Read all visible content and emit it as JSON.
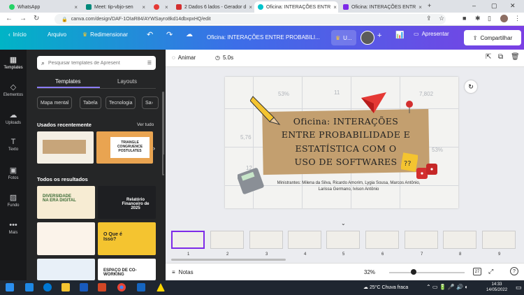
{
  "browser": {
    "tabs": [
      {
        "label": "WhatsApp",
        "color": "#25d366"
      },
      {
        "label": "Meet: tip-vbjo-sen",
        "color": "#00897b"
      },
      {
        "label": "",
        "color": "#e53935"
      },
      {
        "label": "2 Dados 6 lados - Gerador d",
        "color": "#d32f2f"
      },
      {
        "label": "Oficina: INTERAÇÕES ENTR",
        "color": "#00c4cc"
      },
      {
        "label": "Oficina: INTERAÇÕES ENTR",
        "color": "#7d2ae8"
      }
    ],
    "new_tab": "+",
    "url": "canva.com/design/DAF-1OIaR84/AYWSayro8kd14dbxpxHQ/edit"
  },
  "header": {
    "home": "Início",
    "file": "Arquivo",
    "resize": "Redimensionar",
    "title": "Oficina: INTERAÇÕES ENTRE PROBABILI...",
    "user_initial": "U...",
    "present": "Apresentar",
    "share": "Compartilhar"
  },
  "rail": [
    {
      "label": "Templates",
      "icon": "templates-icon"
    },
    {
      "label": "Elementos",
      "icon": "elements-icon"
    },
    {
      "label": "Uploads",
      "icon": "uploads-icon"
    },
    {
      "label": "Texto",
      "icon": "text-icon"
    },
    {
      "label": "Fotos",
      "icon": "photos-icon"
    },
    {
      "label": "Fundo",
      "icon": "background-icon"
    },
    {
      "label": "Mais",
      "icon": "more-icon"
    }
  ],
  "panel": {
    "search_placeholder": "Pesquisar templates de Apresent",
    "tab_templates": "Templates",
    "tab_layouts": "Layouts",
    "chips": [
      "Mapa mental",
      "Tabela",
      "Tecnologia",
      "Sa"
    ],
    "recent_title": "Usados recentemente",
    "see_all": "Ver tudo",
    "all_results": "Todos os resultados",
    "thumbs": {
      "t1": "DIVERSIDADE NA ERA DIGITAL",
      "t2": "Relatório Financeiro de 2025",
      "t3": "O Que é Isso?",
      "t4": "ESPAÇO DE CO-WORKING",
      "t5": "TRIANGLE CONGRUENCE POSTULATES"
    }
  },
  "editor": {
    "animate": "Animar",
    "duration": "5.0s"
  },
  "slide": {
    "title_lines": [
      "Oficina: INTERAÇÕES",
      "ENTRE PROBABILIDADE E",
      "ESTATÍSTICA COM O",
      "USO DE SOFTWARES"
    ],
    "authors": "Ministrantes: Milena da Silva, Ricardo Amorim, Lygia Sousa, Marcos Antônio, Larissa Germano, Ivison Antônio",
    "deco_numbers": [
      "53%",
      "7,802",
      "5,76",
      "53%",
      "12",
      "11"
    ]
  },
  "filmstrip": {
    "pages": [
      "1",
      "2",
      "3",
      "4",
      "5",
      "6",
      "7",
      "8",
      "9"
    ],
    "selected": "1"
  },
  "bottom": {
    "notes": "Notas",
    "zoom": "32%",
    "zoom_fraction": 0.32,
    "page_count": "27"
  },
  "taskbar": {
    "weather": "25°C  Chuva fraca",
    "time": "14:33",
    "date": "14/05/2022"
  }
}
